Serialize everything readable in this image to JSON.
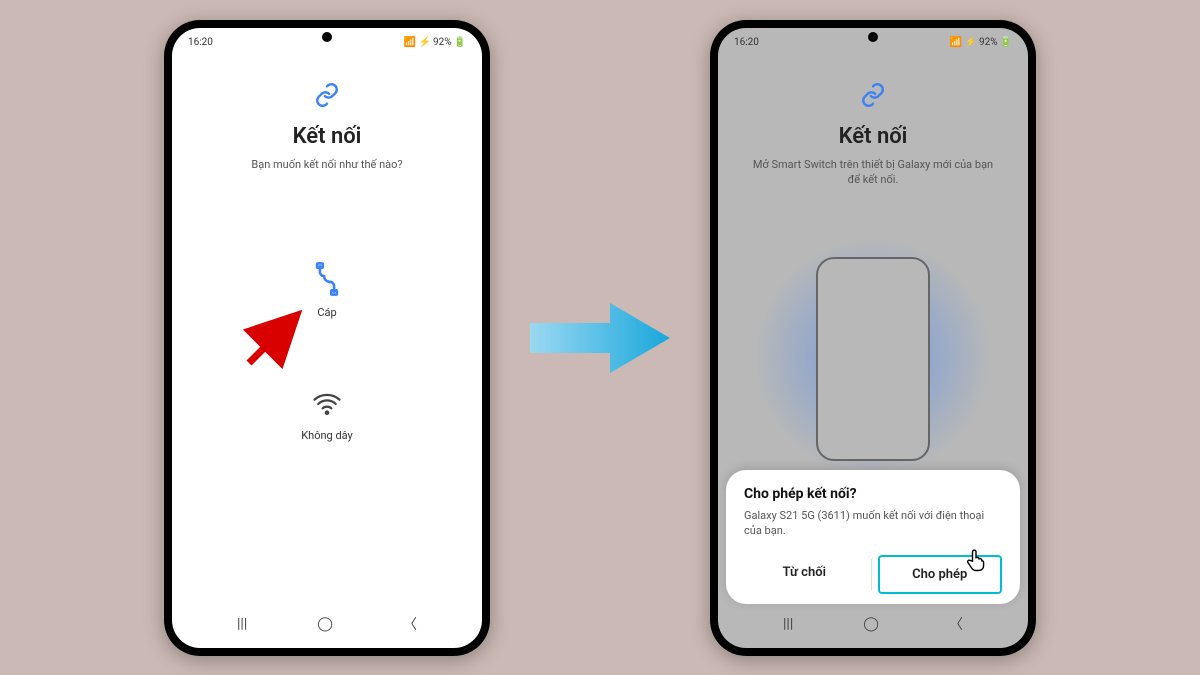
{
  "statusbar": {
    "time": "16:20",
    "right": "92%"
  },
  "phone1": {
    "title": "Kết nối",
    "subtitle": "Bạn muốn kết nối như thế nào?",
    "option_cable": "Cáp",
    "option_wireless": "Không dây"
  },
  "phone2": {
    "title": "Kết nối",
    "subtitle": "Mở Smart Switch trên thiết bị Galaxy mới của bạn để kết nối.",
    "dialog_title": "Cho phép kết nối?",
    "dialog_body": "Galaxy S21 5G (3611) muốn kết nối với điện thoại của bạn.",
    "deny": "Từ chối",
    "allow": "Cho phép"
  }
}
